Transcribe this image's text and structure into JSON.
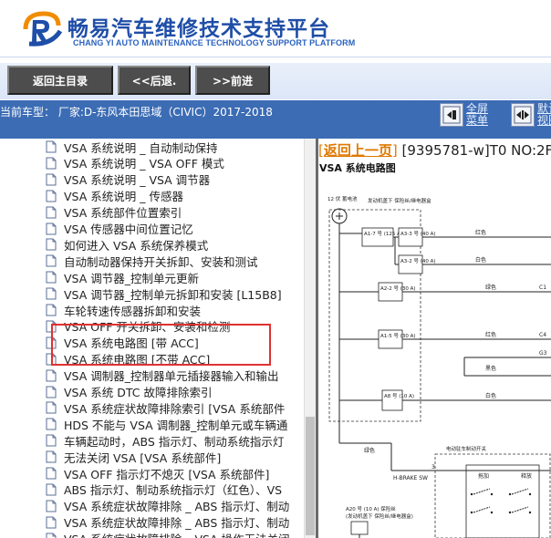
{
  "header": {
    "brand_cn": "畅易汽车维修技术支持平台",
    "brand_en": "CHANG YI AUTO MAINTENANCE TECHNOLOGY SUPPORT PLATFORM",
    "brand_color": "#1f4ea8",
    "logo_colors": [
      "#f08c00",
      "#1f4ea8"
    ]
  },
  "toolbar": {
    "buttons": [
      {
        "label": "返回主目录"
      },
      {
        "label": "<<后退."
      },
      {
        "label": ">>前进"
      }
    ]
  },
  "status": {
    "text": "当前车型：  厂家:D-东风本田思域（CIVIC）2017-2018",
    "controls": [
      {
        "icon": "fullscreen-icon",
        "line1": "全屏",
        "line2": "菜单"
      },
      {
        "icon": "default-view-icon",
        "line1": "默认",
        "line2": "视图"
      }
    ],
    "bg_color": "#3c6cb4"
  },
  "tree": {
    "items": [
      {
        "label": "VSA 系统说明 _ 自动制动保持"
      },
      {
        "label": "VSA 系统说明 _ VSA OFF 模式"
      },
      {
        "label": "VSA 系统说明 _ VSA 调节器"
      },
      {
        "label": "VSA 系统说明 _ 传感器"
      },
      {
        "label": "VSA 系统部件位置索引"
      },
      {
        "label": "VSA 传感器中间位置记忆"
      },
      {
        "label": "如何进入 VSA 系统保养模式"
      },
      {
        "label": "自动制动器保持开关拆卸、安装和测试"
      },
      {
        "label": "VSA 调节器_控制单元更新"
      },
      {
        "label": "VSA 调节器_控制单元拆卸和安装 [L15B8]"
      },
      {
        "label": "车轮转速传感器拆卸和安装"
      },
      {
        "label": "VSA OFF 开关拆卸、安装和检测"
      },
      {
        "label": "VSA 系统电路图 [带 ACC]"
      },
      {
        "label": "VSA 系统电路图 [不带 ACC]"
      },
      {
        "label": "VSA 调制器_控制器单元插接器输入和输出"
      },
      {
        "label": "VSA 系统 DTC 故障排除索引"
      },
      {
        "label": "VSA 系统症状故障排除索引 [VSA 系统部件"
      },
      {
        "label": "HDS 不能与 VSA 调制器_控制单元或车辆通"
      },
      {
        "label": "车辆起动时，ABS 指示灯、制动系统指示灯"
      },
      {
        "label": "无法关闭 VSA [VSA 系统部件]"
      },
      {
        "label": "VSA OFF 指示灯不熄灭 [VSA 系统部件]"
      },
      {
        "label": "ABS 指示灯、制动系统指示灯（红色）、VS"
      },
      {
        "label": "VSA 系统症状故障排除 _ ABS 指示灯、制动"
      },
      {
        "label": "VSA 系统症状故障排除 _ ABS 指示灯、制动"
      },
      {
        "label": "VSA 系统症状故障排除 _ VSA 操作无法关闭"
      }
    ],
    "highlight_color": "#e03131"
  },
  "content": {
    "back_link": "返回上一页",
    "bracket_open": "[",
    "bracket_close": "]",
    "doc_code": "[9395781-w]T0 NO:2F",
    "diagram_title": "VSA 系统电路图",
    "diagram": {
      "battery": "12 伏 蓄电池",
      "fuse_box_title": "发动机盖下 保险丝/继电器盒",
      "fuse_1": "A1-7 号 (125 A)",
      "fuse_2": "A3-3 号 (40 A)",
      "fuse_3": "A3-2 号 (40 A)",
      "fuse_4": "A2-2 号 (30 A)",
      "fuse_5": "A1-5 号 (30 A)",
      "fuse_6": "A8 号 (10 A)",
      "fuse_7": "A20 号 (10 A) 保险丝",
      "fuse_7_sub": "(发动机盖下 保险丝/继电器盒)",
      "wire_red_1": "红色",
      "wire_white_1": "白色",
      "wire_green_1": "绿色",
      "wire_red_2": "红色",
      "wire_black": "黑色",
      "wire_white_2": "白色",
      "wire_green_2": "绿色",
      "pin_c1": "C1",
      "pin_c4": "C4",
      "pin_g3": "G3",
      "brake_switch": "H-BRAKE SW",
      "brake_switch_title": "电动驻车制动开关",
      "num_3": "3",
      "pull_label": "拖加",
      "release_label": "释放"
    }
  }
}
